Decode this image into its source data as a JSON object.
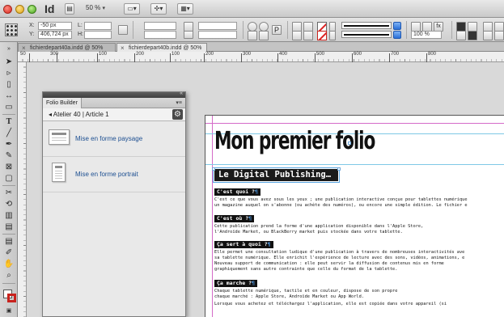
{
  "app": {
    "logo": "Id",
    "zoom": "50 %",
    "colors": {
      "accent": "#2a70d8",
      "stroke_swatch": "#c8221d",
      "link_blue": "#1d4f91"
    }
  },
  "control_panel": {
    "x_label": "X:",
    "x_value": "-50 px",
    "y_label": "Y:",
    "y_value": "406,724 px",
    "w_label": "L:",
    "h_label": "H:",
    "stroke_weight": "100 %"
  },
  "document_tabs": [
    {
      "label": "fichierdepart40a.indd @ 50%",
      "active": false
    },
    {
      "label": "fichierdepart40b.indd @ 50%",
      "active": true
    }
  ],
  "ruler": {
    "labels": [
      "50",
      "300",
      "100",
      "200",
      "100",
      "200",
      "300",
      "400",
      "500",
      "600",
      "700",
      "800"
    ]
  },
  "folio_builder": {
    "tab_label": "Folio Builder",
    "breadcrumb": "◂ Atelier 40 | Article 1",
    "layouts": [
      {
        "label": "Mise en forme paysage",
        "orientation": "landscape"
      },
      {
        "label": "Mise en forme portrait",
        "orientation": "portrait"
      }
    ]
  },
  "document": {
    "title": "Mon premier folio",
    "subtitle": "Le Digital Publishing…",
    "sections": [
      {
        "heading": "C'est quoi ?",
        "lines": [
          "C'est ce que vous avez sous les yeux ; une publication interactive conçue pour tablettes numérique",
          "un magazine auquel on s'abonne (ou achète des numéros), ou encore une simple édition. Le fichier e"
        ]
      },
      {
        "heading": "C'est où ?",
        "lines": [
          "Cette publication prend la forme d'une application disponible dans l'Apple Store,",
          "l'Androïde Market, ou BlackBerry market puis stockée dans votre tablette."
        ]
      },
      {
        "heading": "Ça sert à quoi ?",
        "lines": [
          "Elle permet une consultation ludique d'une publication à travers de nombreuses interactivités ave",
          "sa tablette numérique. Elle enrichit l'expérience de lecture avec des sons, vidéos, animations, e",
          "Nouveau support de communication : elle peut servir la diffusion de contenus mis en forme",
          "graphiquement sans autre contrainte que celle du format de la tablette."
        ]
      },
      {
        "heading": "Ça marche ?",
        "lines": [
          "Chaque tablette numérique, tactile et en couleur, dispose de son propre",
          "chaque marché : Apple Store, Androïde Market ou App World.",
          "Lorsque vous achetez et téléchargez l'application, elle est copiée dans votre appareil (si"
        ]
      }
    ]
  }
}
